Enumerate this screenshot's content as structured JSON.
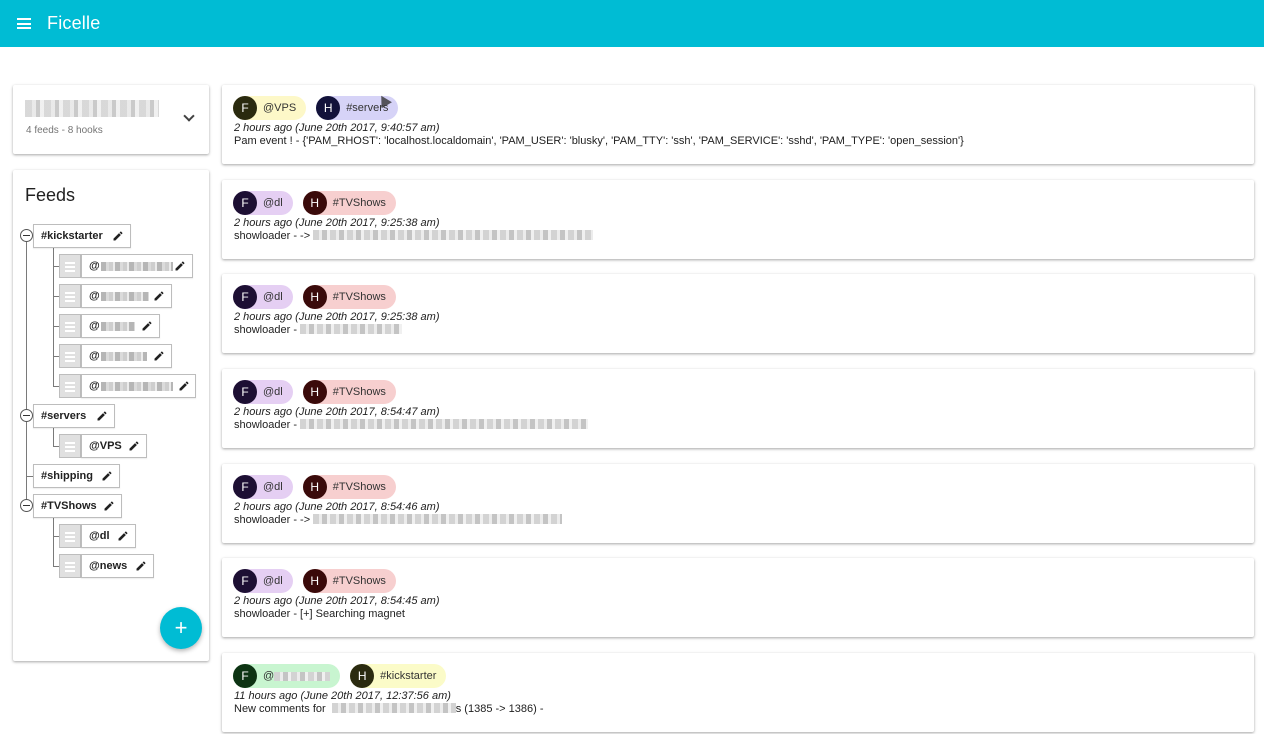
{
  "app": {
    "title": "Ficelle"
  },
  "account": {
    "summary": "4 feeds - 8 hooks"
  },
  "feeds_panel": {
    "title": "Feeds",
    "feeds": [
      {
        "name": "#kickstarter",
        "hooks": [
          "@",
          "@",
          "@",
          "@",
          "@"
        ]
      },
      {
        "name": "#servers",
        "hooks": [
          "@VPS"
        ]
      },
      {
        "name": "#shipping",
        "hooks": []
      },
      {
        "name": "#TVShows",
        "hooks": [
          "@dl",
          "@news"
        ]
      }
    ],
    "add_label": "+"
  },
  "events": [
    {
      "hook": "@VPS",
      "feed": "#servers",
      "hook_letter": "F",
      "feed_letter": "H",
      "hook_color": "#fdf8c8",
      "hook_avatar": "#2a2a0f",
      "feed_color": "#d6d3f7",
      "feed_avatar": "#12123a",
      "time": "2 hours ago (June 20th 2017, 9:40:57 am)",
      "message": "Pam event ! - {'PAM_RHOST': 'localhost.localdomain', 'PAM_USER': 'blusky', 'PAM_TTY': 'ssh', 'PAM_SERVICE': 'sshd', 'PAM_TYPE': 'open_session'}"
    },
    {
      "hook": "@dl",
      "feed": "#TVShows",
      "hook_letter": "F",
      "feed_letter": "H",
      "hook_color": "#e5cff3",
      "hook_avatar": "#1d0f33",
      "feed_color": "#f7cfcf",
      "feed_avatar": "#3a0a0a",
      "time": "2 hours ago (June 20th 2017, 9:25:38 am)",
      "message": "showloader - ->"
    },
    {
      "hook": "@dl",
      "feed": "#TVShows",
      "hook_letter": "F",
      "feed_letter": "H",
      "hook_color": "#e5cff3",
      "hook_avatar": "#1d0f33",
      "feed_color": "#f7cfcf",
      "feed_avatar": "#3a0a0a",
      "time": "2 hours ago (June 20th 2017, 9:25:38 am)",
      "message": "showloader -"
    },
    {
      "hook": "@dl",
      "feed": "#TVShows",
      "hook_letter": "F",
      "feed_letter": "H",
      "hook_color": "#e5cff3",
      "hook_avatar": "#1d0f33",
      "feed_color": "#f7cfcf",
      "feed_avatar": "#3a0a0a",
      "time": "2 hours ago (June 20th 2017, 8:54:47 am)",
      "message": "showloader -"
    },
    {
      "hook": "@dl",
      "feed": "#TVShows",
      "hook_letter": "F",
      "feed_letter": "H",
      "hook_color": "#e5cff3",
      "hook_avatar": "#1d0f33",
      "feed_color": "#f7cfcf",
      "feed_avatar": "#3a0a0a",
      "time": "2 hours ago (June 20th 2017, 8:54:46 am)",
      "message": "showloader - ->"
    },
    {
      "hook": "@dl",
      "feed": "#TVShows",
      "hook_letter": "F",
      "feed_letter": "H",
      "hook_color": "#e5cff3",
      "hook_avatar": "#1d0f33",
      "feed_color": "#f7cfcf",
      "feed_avatar": "#3a0a0a",
      "time": "2 hours ago (June 20th 2017, 8:54:45 am)",
      "message": "showloader - [+] Searching magnet"
    },
    {
      "hook": "@",
      "feed": "#kickstarter",
      "hook_letter": "F",
      "feed_letter": "H",
      "hook_color": "#c8f5d0",
      "hook_avatar": "#0d3313",
      "feed_color": "#fbfbc8",
      "feed_avatar": "#2b2b10",
      "time": "11 hours ago (June 20th 2017, 12:37:56 am)",
      "message": "New comments for ",
      "message_tail": "s (1385 -> 1386) -"
    }
  ],
  "icons": {
    "menu": "menu-icon",
    "expand": "chevron-down-icon",
    "edit": "pencil-icon",
    "drag": "drag-handle-icon",
    "collapse": "collapse-icon",
    "add": "plus-icon"
  },
  "colors": {
    "primary": "#00bcd4"
  }
}
